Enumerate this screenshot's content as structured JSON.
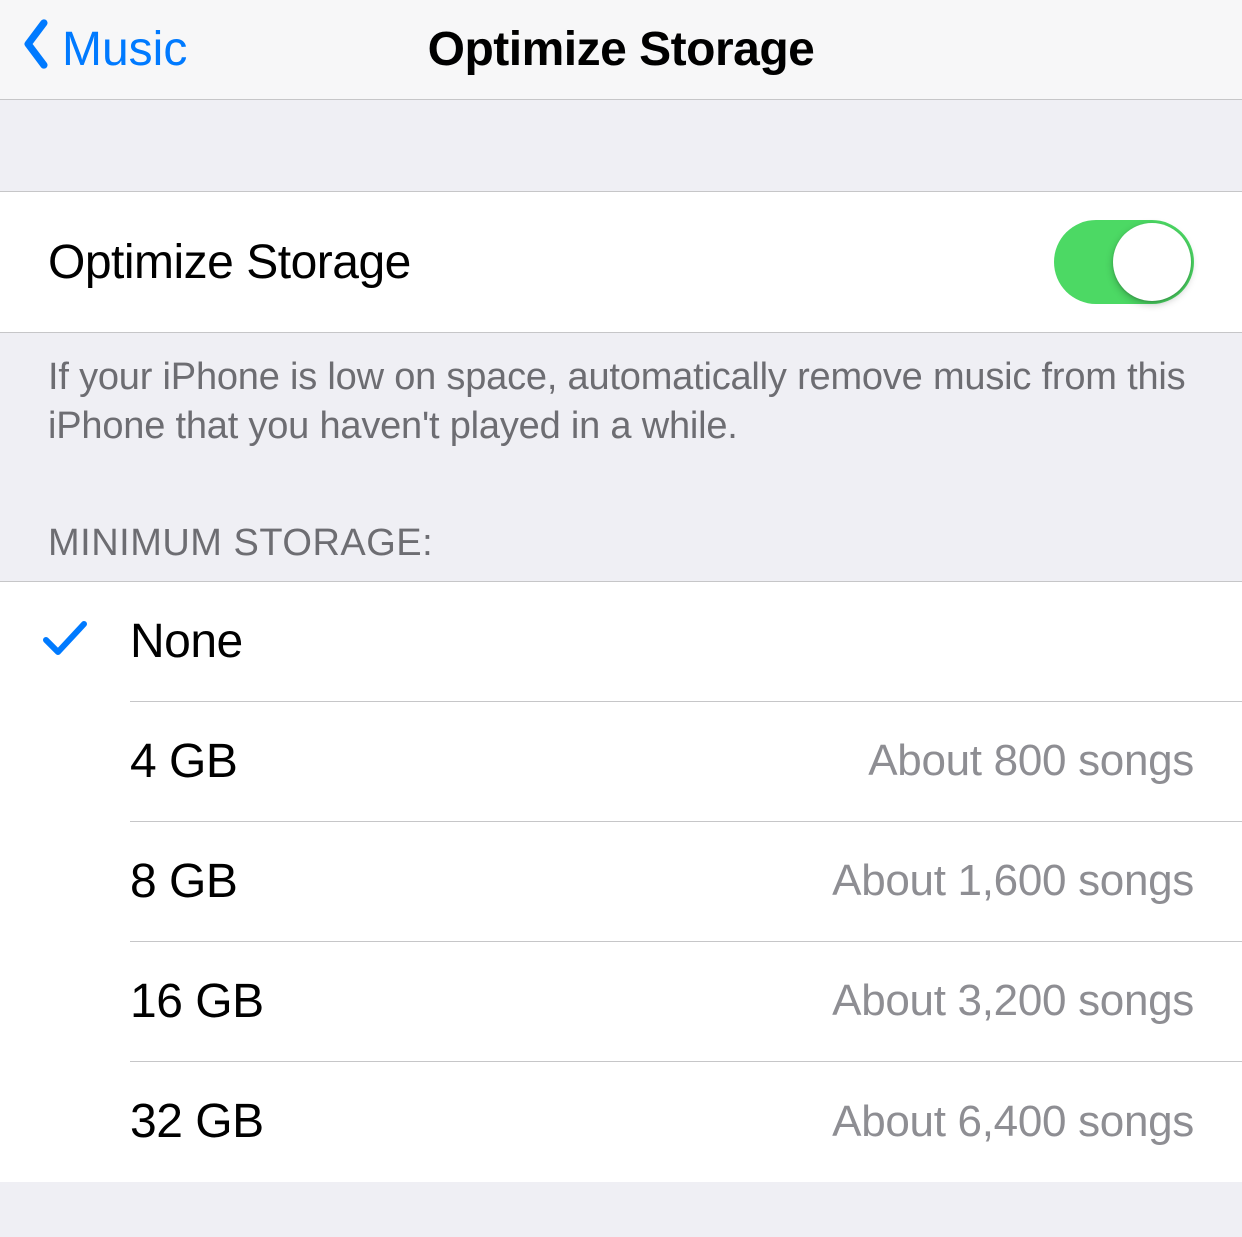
{
  "nav": {
    "back_label": "Music",
    "title": "Optimize Storage"
  },
  "toggle": {
    "label": "Optimize Storage",
    "on": true
  },
  "footer": "If your iPhone is low on space, automatically remove music from this iPhone that you haven't played in a while.",
  "section_header": "MINIMUM STORAGE:",
  "options": [
    {
      "label": "None",
      "detail": "",
      "selected": true
    },
    {
      "label": "4 GB",
      "detail": "About 800 songs",
      "selected": false
    },
    {
      "label": "8 GB",
      "detail": "About 1,600 songs",
      "selected": false
    },
    {
      "label": "16 GB",
      "detail": "About 3,200 songs",
      "selected": false
    },
    {
      "label": "32 GB",
      "detail": "About 6,400 songs",
      "selected": false
    }
  ],
  "colors": {
    "tint": "#007aff",
    "switch_on": "#4cd964"
  }
}
